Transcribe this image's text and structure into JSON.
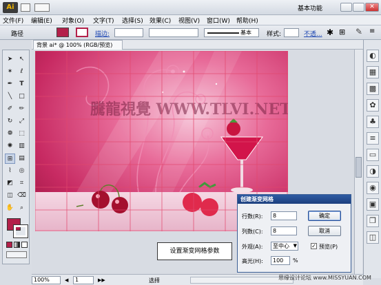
{
  "app": {
    "logo": "Ai",
    "workspace": "基本功能"
  },
  "menu": [
    "文件(F)",
    "编辑(E)",
    "对象(O)",
    "文字(T)",
    "选择(S)",
    "效果(C)",
    "视图(V)",
    "窗口(W)",
    "帮助(H)"
  ],
  "control": {
    "object_type": "路径",
    "stroke_label": "描边:",
    "brush_label": "基本",
    "style_label": "样式:",
    "opacity_label": "不透..."
  },
  "document": {
    "tab_title": "背景 ai* @ 100% (RGB/预览)"
  },
  "watermark_art": "騰龍視覺 WWW.TLVI.NET",
  "callout": "设置渐变网格参数",
  "dialog": {
    "title": "创建渐变网格",
    "rows_label": "行数(R):",
    "rows_value": "8",
    "cols_label": "列数(C):",
    "cols_value": "8",
    "appearance_label": "外观(A):",
    "appearance_value": "至中心",
    "highlight_label": "高光(H):",
    "highlight_value": "100",
    "highlight_unit": "%",
    "ok": "确定",
    "cancel": "取消",
    "preview_label": "预览(P)",
    "preview_checked": true
  },
  "status": {
    "zoom": "100%",
    "page": "1",
    "tool": "选择"
  },
  "site_watermark": "思缘设计论坛 www.MISSYUAN.COM",
  "colors": {
    "fill": "#b3204a",
    "canvas_pink": "#d2336a",
    "mesh_line": "#d84a6b"
  }
}
